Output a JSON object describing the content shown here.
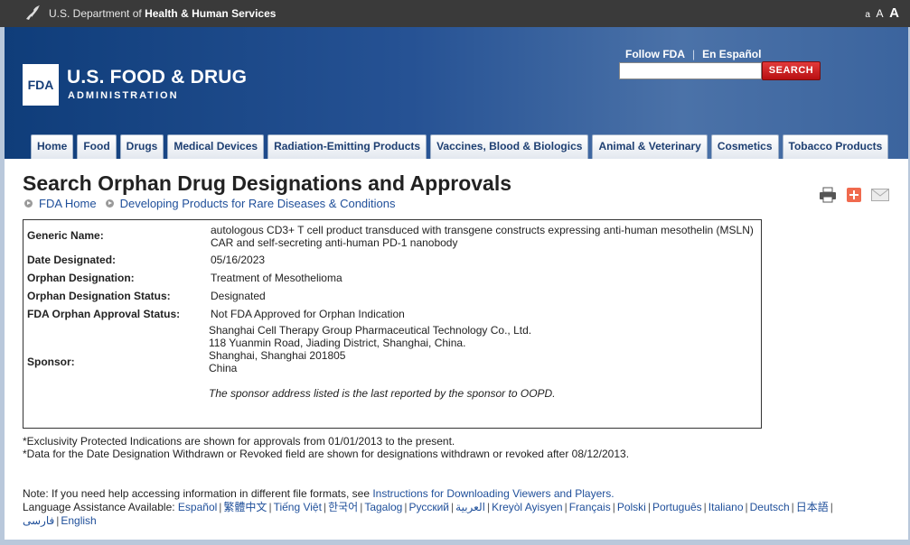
{
  "hhs": {
    "prefix": "U.S. Department of",
    "strong": "Health & Human Services"
  },
  "text_size": [
    "a",
    "A",
    "A"
  ],
  "header": {
    "badge": "FDA",
    "agency_name": "U.S. FOOD & DRUG",
    "agency_sub": "ADMINISTRATION",
    "follow": "Follow FDA",
    "separator": "|",
    "espanol": "En Español",
    "search_button": "SEARCH",
    "search_value": ""
  },
  "nav": [
    "Home",
    "Food",
    "Drugs",
    "Medical Devices",
    "Radiation-Emitting Products",
    "Vaccines, Blood & Biologics",
    "Animal & Veterinary",
    "Cosmetics",
    "Tobacco Products"
  ],
  "page": {
    "title": "Search Orphan Drug Designations and Approvals",
    "breadcrumbs": [
      "FDA Home",
      "Developing Products for Rare Diseases & Conditions"
    ]
  },
  "details": {
    "generic_name_label": "Generic Name:",
    "generic_name_line1": "autologous CD3+ T cell product transduced with transgene constructs expressing anti-human mesothelin (MSLN)",
    "generic_name_line2": "CAR and self-secreting anti-human PD-1 nanobody",
    "date_label": "Date Designated:",
    "date": "05/16/2023",
    "designation_label": "Orphan Designation:",
    "designation": "Treatment of Mesothelioma",
    "status_label": "Orphan Designation Status:",
    "status": "Designated",
    "approval_label": "FDA Orphan Approval Status:",
    "approval": "Not FDA Approved for Orphan Indication",
    "sponsor_label": "Sponsor:",
    "sponsor_lines": [
      "Shanghai Cell Therapy Group Pharmaceutical Technology Co., Ltd.",
      "118 Yuanmin Road, Jiading District, Shanghai, China.",
      "Shanghai, Shanghai 201805",
      "China"
    ],
    "sponsor_note": "The sponsor address listed is the last reported by the sponsor to OOPD."
  },
  "notes": [
    "*Exclusivity Protected Indications are shown for approvals from 01/01/2013 to the present.",
    "*Data for the Date Designation Withdrawn or Revoked field are shown for designations withdrawn or revoked after 08/12/2013."
  ],
  "help": {
    "note_prefix": "Note: If you need help accessing information in different file formats, see",
    "note_link": "Instructions for Downloading Viewers and Players.",
    "language_label": "Language Assistance Available:",
    "languages": [
      "Español",
      "繁體中文",
      "Tiếng Việt",
      "한국어",
      "Tagalog",
      "Русский",
      "العربية",
      "Kreyòl Ayisyen",
      "Français",
      "Polski",
      "Português",
      "Italiano",
      "Deutsch",
      "日本語",
      "فارسی",
      "English"
    ]
  }
}
